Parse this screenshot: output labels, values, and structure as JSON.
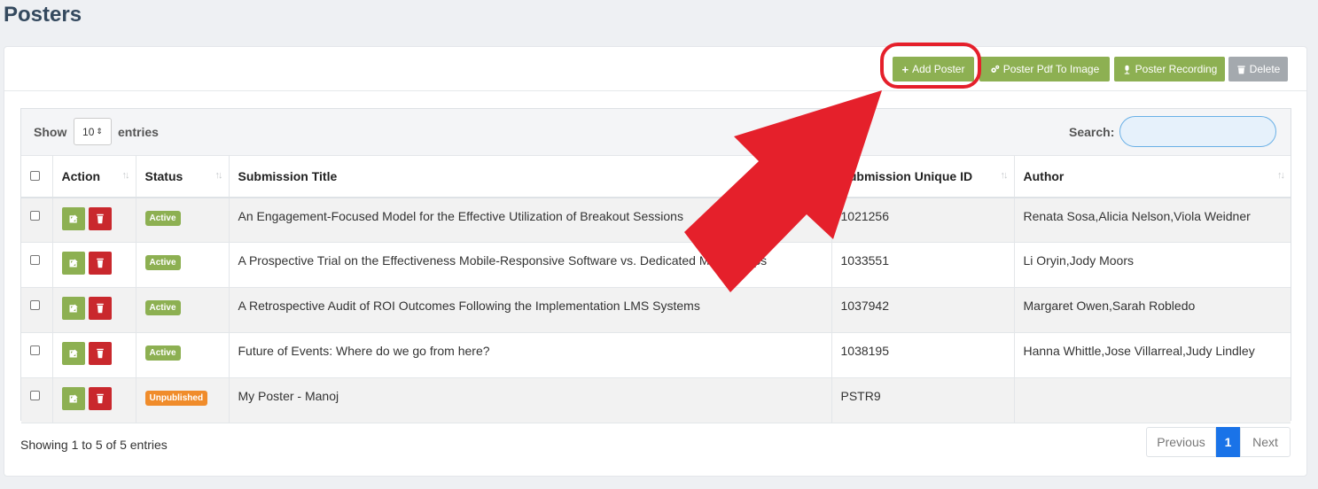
{
  "page": {
    "title": "Posters"
  },
  "toolbar": {
    "add_poster": "Add Poster",
    "pdf_to_image": "Poster Pdf To Image",
    "recording": "Poster Recording",
    "delete": "Delete"
  },
  "table_controls": {
    "show_label": "Show",
    "page_length": "10",
    "entries_label": "entries",
    "search_label": "Search:",
    "search_value": ""
  },
  "columns": [
    "Action",
    "Status",
    "Submission Title",
    "Submission Unique ID",
    "Author"
  ],
  "rows": [
    {
      "status": "Active",
      "title": "An Engagement-Focused Model for the Effective Utilization of Breakout Sessions",
      "uid": "1021256",
      "author": "Renata Sosa,Alicia Nelson,Viola Weidner"
    },
    {
      "status": "Active",
      "title": "A Prospective Trial on the Effectiveness Mobile-Responsive Software vs. Dedicated Mobile Apps",
      "uid": "1033551",
      "author": "Li Oryin,Jody Moors"
    },
    {
      "status": "Active",
      "title": "A Retrospective Audit of ROI Outcomes Following the Implementation LMS Systems",
      "uid": "1037942",
      "author": "Margaret Owen,Sarah Robledo"
    },
    {
      "status": "Active",
      "title": "Future of Events: Where do we go from here?",
      "uid": "1038195",
      "author": "Hanna Whittle,Jose Villarreal,Judy Lindley"
    },
    {
      "status": "Unpublished",
      "title": "My Poster - Manoj",
      "uid": "PSTR9",
      "author": ""
    }
  ],
  "footer": {
    "info": "Showing 1 to 5 of 5 entries",
    "prev": "Previous",
    "current_page": "1",
    "next": "Next"
  },
  "colors": {
    "accent_green": "#8db052",
    "danger_red": "#c9282d",
    "badge_orange": "#f08c2b",
    "page_blue": "#1a73e8",
    "annotation_red": "#e5202b"
  }
}
